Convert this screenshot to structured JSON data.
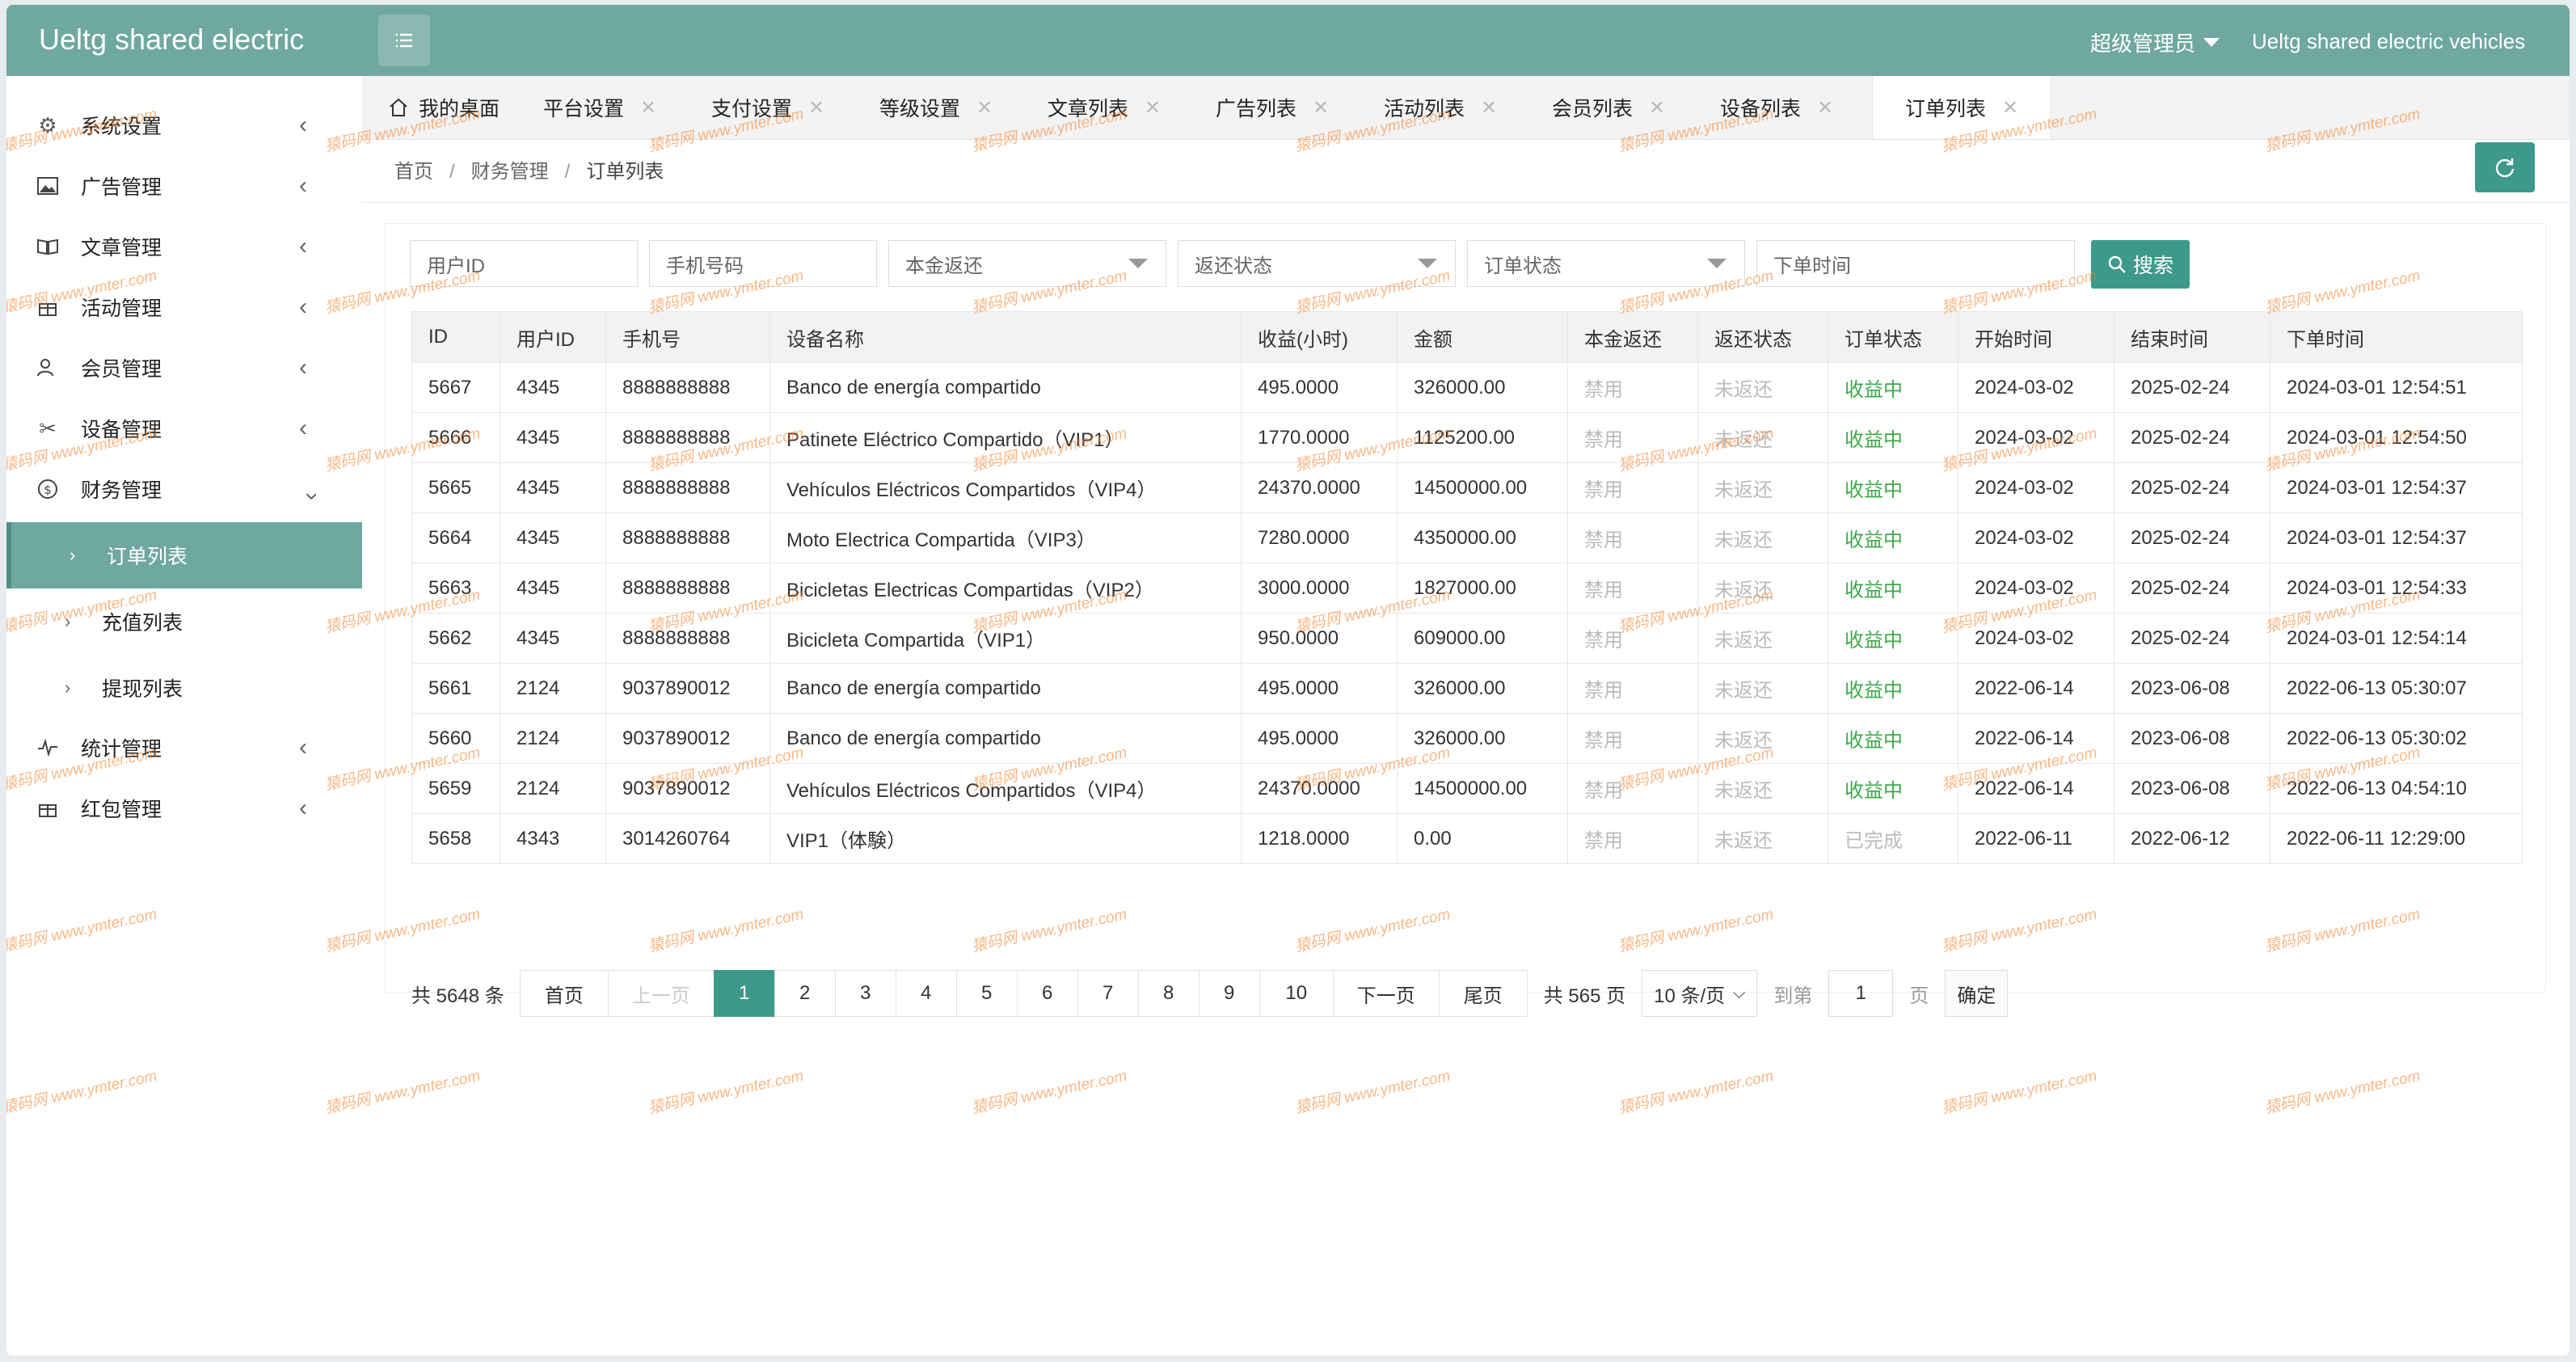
{
  "header": {
    "logo": "Ueltg shared electric",
    "user": "超级管理员",
    "site_name": "Ueltg shared electric vehicles"
  },
  "sidebar": {
    "items": [
      {
        "label": "系统设置",
        "icon": "gear-icon"
      },
      {
        "label": "广告管理",
        "icon": "image-icon"
      },
      {
        "label": "文章管理",
        "icon": "book-icon"
      },
      {
        "label": "活动管理",
        "icon": "gift-icon"
      },
      {
        "label": "会员管理",
        "icon": "users-icon"
      },
      {
        "label": "设备管理",
        "icon": "tools-icon"
      },
      {
        "label": "财务管理",
        "icon": "dollar-icon"
      }
    ],
    "finance_sub": [
      {
        "label": "订单列表"
      },
      {
        "label": "充值列表"
      },
      {
        "label": "提现列表"
      }
    ],
    "bottom_items": [
      {
        "label": "统计管理",
        "icon": "pulse-icon"
      },
      {
        "label": "红包管理",
        "icon": "gift-icon"
      }
    ]
  },
  "tabs": [
    {
      "label": "我的桌面"
    },
    {
      "label": "平台设置"
    },
    {
      "label": "支付设置"
    },
    {
      "label": "等级设置"
    },
    {
      "label": "文章列表"
    },
    {
      "label": "广告列表"
    },
    {
      "label": "活动列表"
    },
    {
      "label": "会员列表"
    },
    {
      "label": "设备列表"
    },
    {
      "label": "订单列表"
    }
  ],
  "breadcrumb": {
    "home": "首页",
    "section": "财务管理",
    "current": "订单列表"
  },
  "filters": {
    "user_id": "用户ID",
    "phone": "手机号码",
    "principal": "本金返还",
    "return_status": "返还状态",
    "order_status": "订单状态",
    "order_time": "下单时间",
    "search": "搜索"
  },
  "table": {
    "headers": [
      "ID",
      "用户ID",
      "手机号",
      "设备名称",
      "收益(小时)",
      "金额",
      "本金返还",
      "返还状态",
      "订单状态",
      "开始时间",
      "结束时间",
      "下单时间"
    ],
    "rows": [
      [
        "5667",
        "4345",
        "8888888888",
        "Banco de energía compartido",
        "495.0000",
        "326000.00",
        "禁用",
        "未返还",
        "收益中",
        "2024-03-02",
        "2025-02-24",
        "2024-03-01 12:54:51"
      ],
      [
        "5666",
        "4345",
        "8888888888",
        "Patinete Eléctrico Compartido（VIP1）",
        "1770.0000",
        "1125200.00",
        "禁用",
        "未返还",
        "收益中",
        "2024-03-02",
        "2025-02-24",
        "2024-03-01 12:54:50"
      ],
      [
        "5665",
        "4345",
        "8888888888",
        "Vehículos Eléctricos Compartidos（VIP4）",
        "24370.0000",
        "14500000.00",
        "禁用",
        "未返还",
        "收益中",
        "2024-03-02",
        "2025-02-24",
        "2024-03-01 12:54:37"
      ],
      [
        "5664",
        "4345",
        "8888888888",
        "Moto Electrica Compartida（VIP3）",
        "7280.0000",
        "4350000.00",
        "禁用",
        "未返还",
        "收益中",
        "2024-03-02",
        "2025-02-24",
        "2024-03-01 12:54:37"
      ],
      [
        "5663",
        "4345",
        "8888888888",
        "Bicicletas Electricas Compartidas（VIP2）",
        "3000.0000",
        "1827000.00",
        "禁用",
        "未返还",
        "收益中",
        "2024-03-02",
        "2025-02-24",
        "2024-03-01 12:54:33"
      ],
      [
        "5662",
        "4345",
        "8888888888",
        "Bicicleta Compartida（VIP1）",
        "950.0000",
        "609000.00",
        "禁用",
        "未返还",
        "收益中",
        "2024-03-02",
        "2025-02-24",
        "2024-03-01 12:54:14"
      ],
      [
        "5661",
        "2124",
        "9037890012",
        "Banco de energía compartido",
        "495.0000",
        "326000.00",
        "禁用",
        "未返还",
        "收益中",
        "2022-06-14",
        "2023-06-08",
        "2022-06-13 05:30:07"
      ],
      [
        "5660",
        "2124",
        "9037890012",
        "Banco de energía compartido",
        "495.0000",
        "326000.00",
        "禁用",
        "未返还",
        "收益中",
        "2022-06-14",
        "2023-06-08",
        "2022-06-13 05:30:02"
      ],
      [
        "5659",
        "2124",
        "9037890012",
        "Vehículos Eléctricos Compartidos（VIP4）",
        "24370.0000",
        "14500000.00",
        "禁用",
        "未返还",
        "收益中",
        "2022-06-14",
        "2023-06-08",
        "2022-06-13 04:54:10"
      ],
      [
        "5658",
        "4343",
        "3014260764",
        "VIP1（体験）",
        "1218.0000",
        "0.00",
        "禁用",
        "未返还",
        "已完成",
        "2022-06-11",
        "2022-06-12",
        "2022-06-11 12:29:00"
      ]
    ]
  },
  "pagination": {
    "total": "共 5648 条",
    "first": "首页",
    "prev": "上一页",
    "pages": [
      "1",
      "2",
      "3",
      "4",
      "5",
      "6",
      "7",
      "8",
      "9",
      "10"
    ],
    "next": "下一页",
    "last": "尾页",
    "page_count": "共 565 页",
    "page_size": "10 条/页",
    "goto": "到第",
    "goto_value": "1",
    "page_unit": "页",
    "confirm": "确定"
  },
  "watermark": "猿码网 www.ymter.com",
  "colors": {
    "header": "#6fa8a0",
    "accent": "#3d9a8a",
    "active_status": "#3caa4b"
  }
}
